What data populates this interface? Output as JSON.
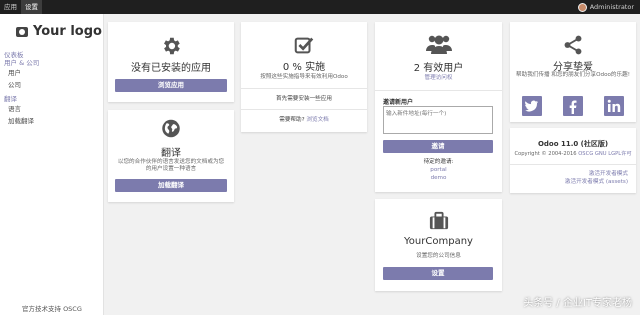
{
  "topbar": {
    "menu": [
      "应用",
      "设置"
    ],
    "active_index": 1,
    "user": "Administrator"
  },
  "sidebar": {
    "logo": "Your logo",
    "groups": [
      {
        "label": "仪表板",
        "items": []
      },
      {
        "label": "用户 & 公司",
        "items": [
          "用户",
          "公司"
        ]
      },
      {
        "label": "翻译",
        "items": [
          "语言",
          "加载翻译"
        ]
      }
    ],
    "support": "官方技术支持 OSCG"
  },
  "apps_card": {
    "title": "没有已安装的应用",
    "button": "浏览应用"
  },
  "translate_card": {
    "title": "翻译",
    "desc": "以您的合作伙伴的语言发送您的文档或为您的用户设置一种语言",
    "button": "加载翻译"
  },
  "impl_card": {
    "title": "0 % 实施",
    "desc": "按照这些实施指导来有效利用Odoo",
    "install_first": "首先需要安装一些应用",
    "help_prefix": "需要帮助?",
    "help_link": "浏览文档"
  },
  "users_card": {
    "title": "2 有效用户",
    "manage_link": "管理访问权",
    "invite_label": "邀请新用户",
    "invite_placeholder": "输入新件地址(每行一个)",
    "invite_button": "邀请",
    "pending_label": "待定的邀请:",
    "pending": [
      "portal",
      "demo"
    ]
  },
  "company_card": {
    "title": "YourCompany",
    "desc": "设置您的公司信息",
    "button": "设置"
  },
  "share_card": {
    "title": "分享挚爱",
    "desc": "帮助我们传播 和您的朋友们分享Odoo的乐趣!",
    "socials": [
      "twitter-icon",
      "facebook-icon",
      "linkedin-icon"
    ]
  },
  "about_card": {
    "title": "Odoo 11.0 (社区版)",
    "copyright_prefix": "Copyright © 2004-2016",
    "copyright_links": [
      "OSCG",
      "GNU LGPL许可"
    ],
    "dev_mode": "激活开发者模式",
    "dev_mode_assets": "激活开发者模式 (assets)"
  },
  "watermark": "头条号 / 企业IT专家老杨",
  "colors": {
    "accent": "#7c7bad",
    "topbar": "#1f1f1f"
  }
}
